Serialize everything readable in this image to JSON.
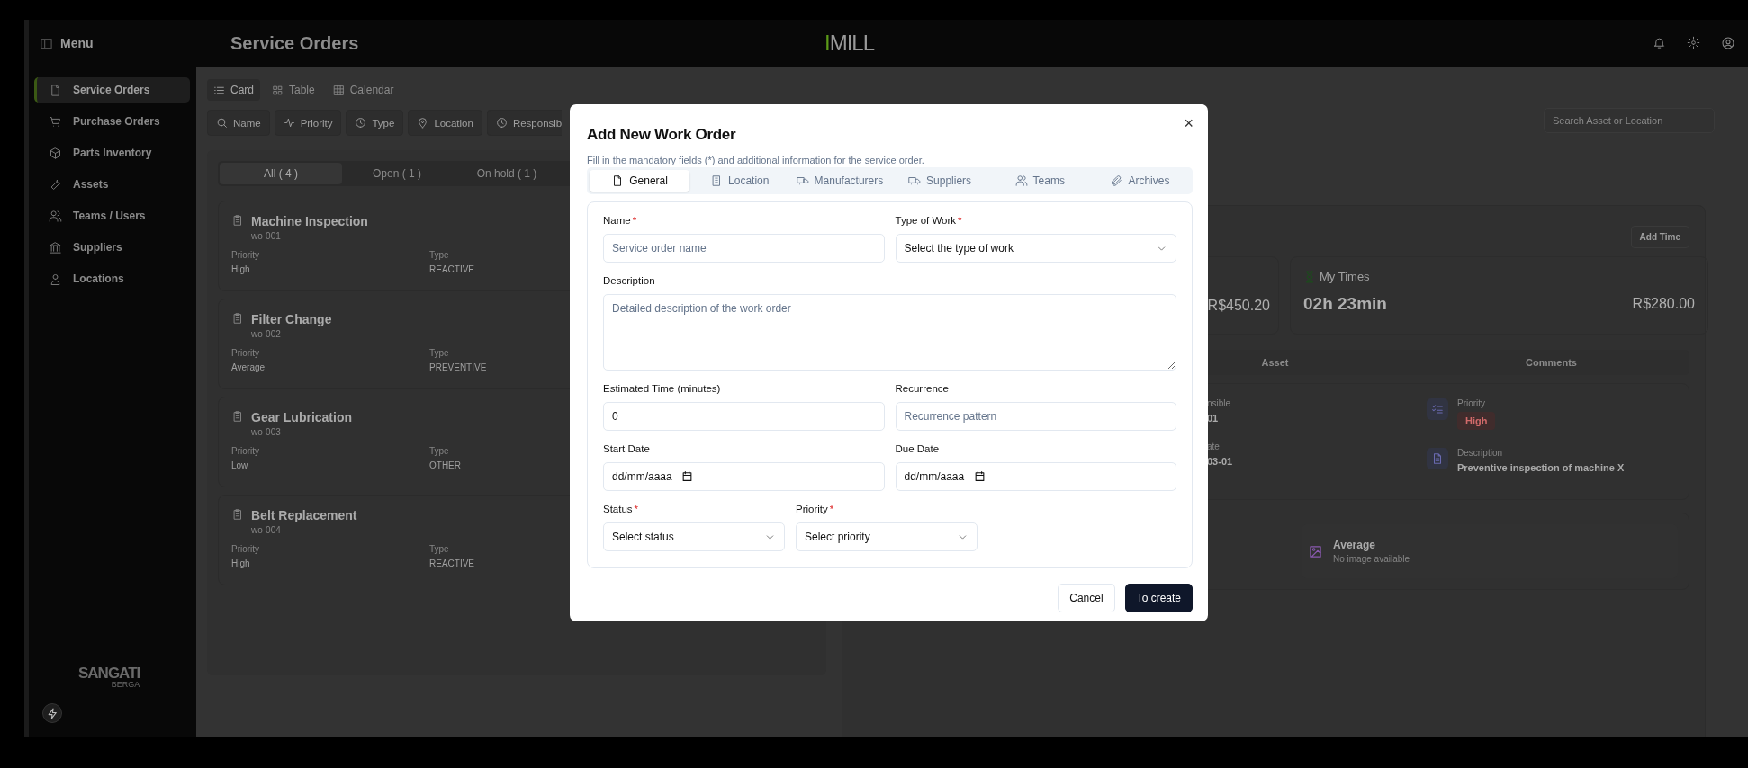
{
  "header": {
    "title": "Service Orders",
    "logo": {
      "accent": "I",
      "text": "MILL"
    }
  },
  "sidebar": {
    "title": "Menu",
    "items": [
      {
        "label": "Service Orders",
        "selected": true
      },
      {
        "label": "Purchase Orders",
        "selected": false
      },
      {
        "label": "Parts Inventory",
        "selected": false
      },
      {
        "label": "Assets",
        "selected": false
      },
      {
        "label": "Teams / Users",
        "selected": false
      },
      {
        "label": "Suppliers",
        "selected": false
      },
      {
        "label": "Locations",
        "selected": false
      }
    ],
    "brand": {
      "name": "SANGATI",
      "sub": "BERGA"
    }
  },
  "view_tabs": [
    {
      "label": "Card",
      "selected": true
    },
    {
      "label": "Table",
      "selected": false
    },
    {
      "label": "Calendar",
      "selected": false
    }
  ],
  "filters": [
    "Name",
    "Priority",
    "Type",
    "Location",
    "Responsib"
  ],
  "status_tabs": [
    {
      "label": "All ( 4 )",
      "selected": true
    },
    {
      "label": "Open ( 1 )",
      "selected": false
    },
    {
      "label": "On hold ( 1 )",
      "selected": false
    }
  ],
  "orders": [
    {
      "title": "Machine Inspection",
      "code": "wo-001",
      "priority_label": "Priority",
      "priority": "High",
      "type_label": "Type",
      "type": "REACTIVE"
    },
    {
      "title": "Filter Change",
      "code": "wo-002",
      "priority_label": "Priority",
      "priority": "Average",
      "type_label": "Type",
      "type": "PREVENTIVE"
    },
    {
      "title": "Gear Lubrication",
      "code": "wo-003",
      "priority_label": "Priority",
      "priority": "Low",
      "type_label": "Type",
      "type": "OTHER"
    },
    {
      "title": "Belt Replacement",
      "code": "wo-004",
      "priority_label": "Priority",
      "priority": "High",
      "type_label": "Type",
      "type": "REACTIVE"
    }
  ],
  "search": {
    "placeholder": "Search Asset or Location"
  },
  "detail": {
    "add_time": "Add Time",
    "cost_cards": [
      {
        "value": "R$450.20"
      },
      {
        "title": "My Times",
        "time": "02h 23min",
        "value": "R$280.00"
      }
    ],
    "tabs": [
      "Asset",
      "Comments"
    ],
    "info_cut": [
      {
        "label": "nsible",
        "value": "01"
      },
      {
        "label": "ate",
        "value": "03-01"
      }
    ],
    "info": [
      {
        "kind": "badge",
        "label": "Priority",
        "value": "High"
      },
      {
        "kind": "text",
        "label": "Description",
        "value": "Preventive inspection of machine X"
      }
    ],
    "image_card": {
      "title": "Average",
      "note": "No image available"
    }
  },
  "modal": {
    "title": "Add New Work Order",
    "subtitle": "Fill in the mandatory fields (*) and additional information for the service order.",
    "close": "×",
    "tabs": [
      {
        "label": "General",
        "selected": true
      },
      {
        "label": "Location",
        "selected": false
      },
      {
        "label": "Manufacturers",
        "selected": false
      },
      {
        "label": "Suppliers",
        "selected": false
      },
      {
        "label": "Teams",
        "selected": false
      },
      {
        "label": "Archives",
        "selected": false
      }
    ],
    "rows": [
      [
        {
          "kind": "text",
          "label": "Name",
          "required_mark": "*",
          "placeholder": "Service order name"
        },
        {
          "kind": "select",
          "label": "Type of Work",
          "required_mark": "*",
          "value": "Select the type of work"
        }
      ],
      [
        {
          "kind": "textarea",
          "label": "Description",
          "placeholder": "Detailed description of the work order"
        }
      ],
      [
        {
          "kind": "text",
          "label": "Estimated Time (minutes)",
          "value": "0"
        },
        {
          "kind": "text",
          "label": "Recurrence",
          "placeholder": "Recurrence pattern"
        }
      ],
      [
        {
          "kind": "date",
          "label": "Start Date",
          "placeholder": "dd/mm/aaaa"
        },
        {
          "kind": "date",
          "label": "Due Date",
          "placeholder": "dd/mm/aaaa"
        }
      ],
      [
        {
          "kind": "select",
          "label": "Status",
          "required_mark": "*",
          "value": "Select status"
        },
        {
          "kind": "select",
          "label": "Priority",
          "required_mark": "*",
          "value": "Select priority"
        }
      ]
    ],
    "buttons": [
      {
        "label": "Cancel",
        "kind": "secondary"
      },
      {
        "label": "To create",
        "kind": "primary"
      }
    ]
  }
}
